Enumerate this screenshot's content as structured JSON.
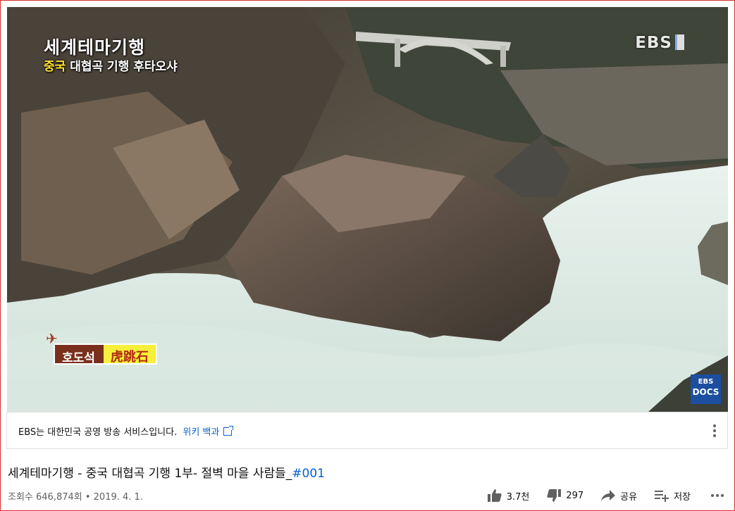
{
  "video": {
    "program_logo": "세계테마기행",
    "subtitle_country": "중국",
    "subtitle_rest": "대협곡 기행  후타오샤",
    "channel_logo": "EBS",
    "caption_korean": "호도석",
    "caption_chinese": "虎跳石",
    "corner_logo_line1": "EBS",
    "corner_logo_line2": "DOCS"
  },
  "info_panel": {
    "text": "EBS는 대한민국 공영 방송 서비스입니다.",
    "link": "위키 백과"
  },
  "title": {
    "main": "세계테마기행 - 중국 대협곡 기행 1부- 절벽 마을 사람들_",
    "hashtag": "#001"
  },
  "meta": {
    "views": "조회수 646,874회 • 2019. 4. 1."
  },
  "actions": {
    "like_count": "3.7천",
    "dislike_count": "297",
    "share_label": "공유",
    "save_label": "저장"
  }
}
